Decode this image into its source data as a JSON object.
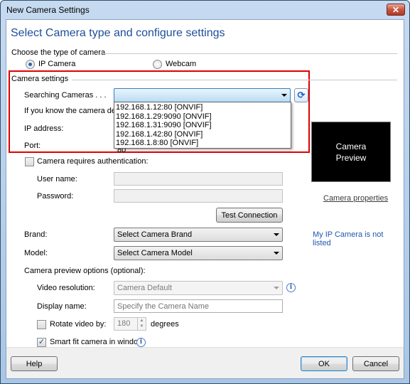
{
  "window": {
    "title": "New Camera Settings"
  },
  "heading": "Select Camera type and configure settings",
  "camera_type": {
    "group_label": "Choose the type of camera",
    "options": [
      {
        "label": "IP Camera",
        "selected": true
      },
      {
        "label": "Webcam",
        "selected": false
      }
    ]
  },
  "camera_settings": {
    "group_label": "Camera settings",
    "searching_label": "Searching Cameras . . .",
    "search_combo_value": "",
    "discovered_cameras": [
      "192.168.1.12:80 [ONVIF]",
      "192.168.1.29:9090 [ONVIF]",
      "192.168.1.31:9090 [ONVIF]",
      "192.168.1.42:80 [ONVIF]",
      "192.168.1.8:80 [ONVIF]"
    ],
    "hint_text": "If you know the camera detai",
    "ip_label": "IP address:",
    "port_label": "Port:",
    "port_value": "80"
  },
  "auth": {
    "checkbox_label": "Camera requires authentication:",
    "checked": false,
    "username_label": "User name:",
    "username_value": "",
    "password_label": "Password:",
    "password_value": "",
    "test_button": "Test Connection"
  },
  "preview": {
    "line1": "Camera",
    "line2": "Preview",
    "properties_link": "Camera properties"
  },
  "brand": {
    "label": "Brand:",
    "value": "Select Camera Brand"
  },
  "model": {
    "label": "Model:",
    "value": "Select Camera Model"
  },
  "not_listed_link": "My IP Camera is not listed",
  "preview_options": {
    "label": "Camera preview options (optional):",
    "resolution_label": "Video resolution:",
    "resolution_value": "Camera Default",
    "display_name_label": "Display name:",
    "display_name_placeholder": "Specify the Camera Name",
    "rotate_label": "Rotate video by:",
    "rotate_checked": false,
    "rotate_value": "180",
    "degrees_label": "degrees",
    "smart_fit_label": "Smart fit camera in window",
    "smart_fit_checked": true
  },
  "footer": {
    "help": "Help",
    "ok": "OK",
    "cancel": "Cancel"
  }
}
